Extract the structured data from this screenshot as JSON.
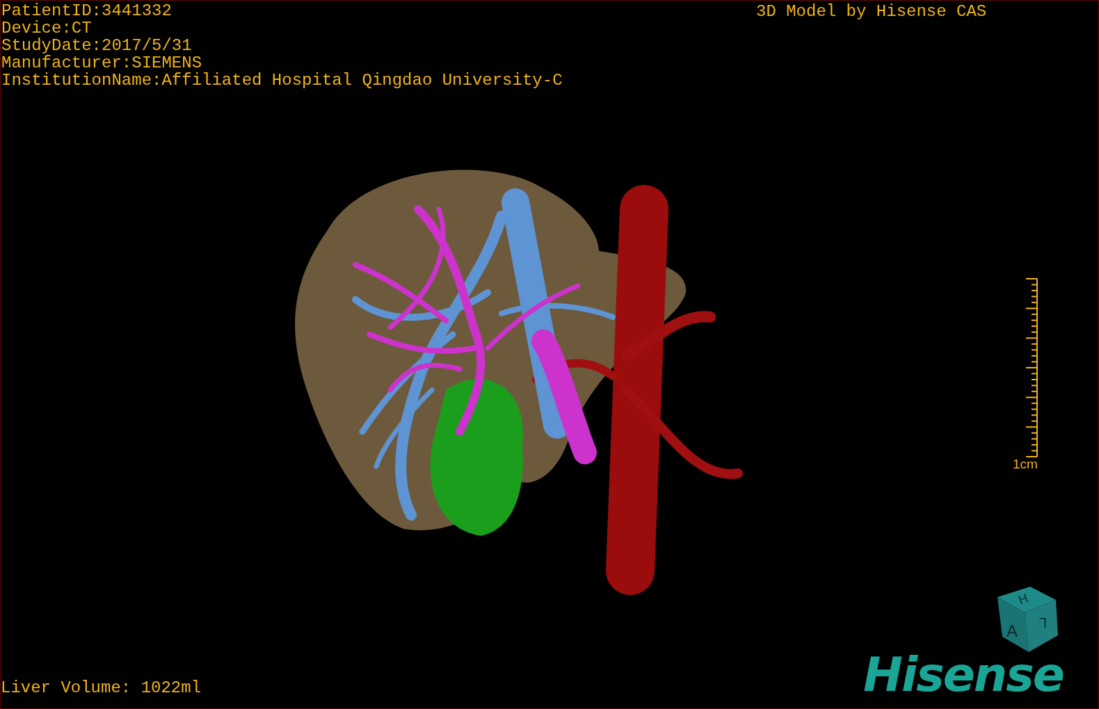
{
  "patient_info": [
    "PatientID:3441332",
    "Device:CT",
    "StudyDate:2017/5/31",
    "Manufacturer:SIEMENS",
    "InstitutionName:Affiliated Hospital Qingdao University-C"
  ],
  "title": "3D Model by Hisense CAS",
  "scale_bar": {
    "label": "1cm"
  },
  "orientation_cube": {
    "faces": [
      "H",
      "A",
      "L"
    ]
  },
  "liver_volume": "Liver Volume: 1022ml",
  "logo": "Hisense"
}
